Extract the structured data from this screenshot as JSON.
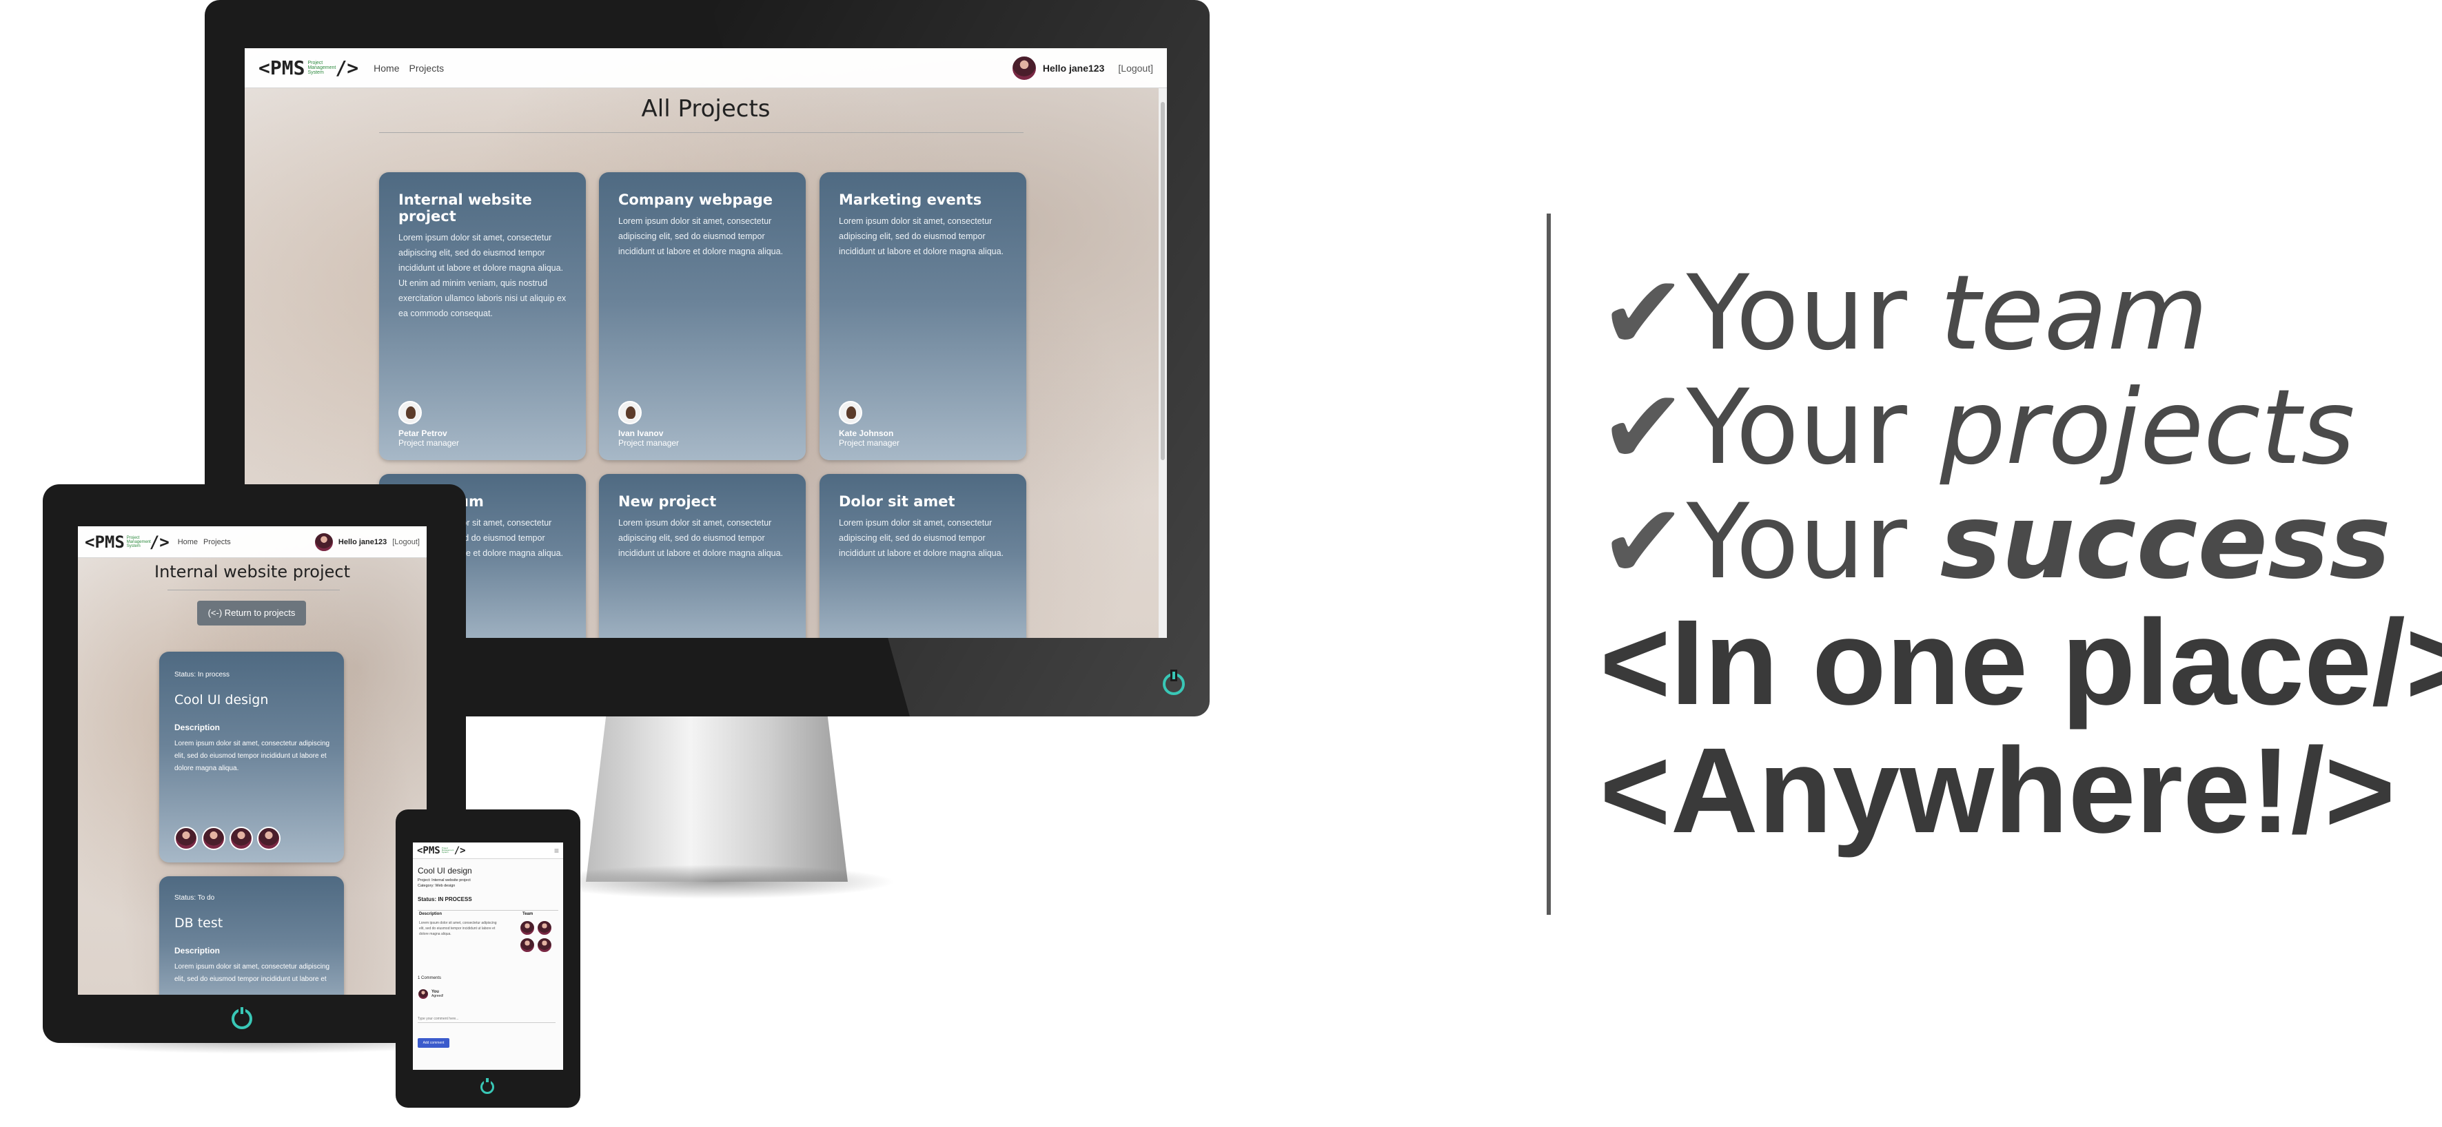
{
  "desktop": {
    "nav": {
      "logo_main": "<PMS",
      "logo_sub": "Project Management System",
      "logo_end": "/>",
      "home": "Home",
      "projects": "Projects",
      "user": "Hello jane123",
      "logout": "[Logout]"
    },
    "heading": "All Projects",
    "cards": [
      {
        "title": "Internal website project",
        "text": "Lorem ipsum dolor sit amet, consectetur adipiscing elit, sed do eiusmod tempor incididunt ut labore et dolore magna aliqua. Ut enim ad minim veniam, quis nostrud exercitation ullamco laboris nisi ut aliquip ex ea commodo consequat.",
        "manager": "Petar Petrov",
        "role": "Project manager"
      },
      {
        "title": "Company webpage",
        "text": "Lorem ipsum dolor sit amet, consectetur adipiscing elit, sed do eiusmod tempor incididunt ut labore et dolore magna aliqua.",
        "manager": "Ivan Ivanov",
        "role": "Project manager"
      },
      {
        "title": "Marketing events",
        "text": "Lorem ipsum dolor sit amet, consectetur adipiscing elit, sed do eiusmod tempor incididunt ut labore et dolore magna aliqua.",
        "manager": "Kate Johnson",
        "role": "Project manager"
      },
      {
        "title": "um",
        "text": "Lorem ipsum dolor sit amet, consectetur adipiscing elit, sed do eiusmod tempor incididunt ut labore et dolore magna aliqua."
      },
      {
        "title": "New project",
        "text": "Lorem ipsum dolor sit amet, consectetur adipiscing elit, sed do eiusmod tempor incididunt ut labore et dolore magna aliqua."
      },
      {
        "title": "Dolor sit amet",
        "text": "Lorem ipsum dolor sit amet, consectetur adipiscing elit, sed do eiusmod tempor incididunt ut labore et dolore magna aliqua."
      }
    ]
  },
  "tablet": {
    "nav": {
      "logo_main": "<PMS",
      "logo_sub": "Project Management System",
      "logo_end": "/>",
      "home": "Home",
      "projects": "Projects",
      "user": "Hello jane123",
      "logout": "[Logout]"
    },
    "heading": "Internal website project",
    "return_btn": "(<-) Return to projects",
    "tasks": [
      {
        "status": "Status: In process",
        "title": "Cool UI design",
        "desc_label": "Description",
        "desc": "Lorem ipsum dolor sit amet, consectetur adipiscing elit, sed do eiusmod tempor incididunt ut labore et dolore magna aliqua."
      },
      {
        "status": "Status: To do",
        "title": "DB test",
        "desc_label": "Description",
        "desc": "Lorem ipsum dolor sit amet, consectetur adipiscing elit, sed do eiusmod tempor incididunt ut labore et"
      }
    ]
  },
  "phone": {
    "nav": {
      "logo_main": "<PMS",
      "logo_sub": "Project Management System",
      "logo_end": "/>",
      "menu": "≡"
    },
    "title": "Cool UI design",
    "project_line": "Project: Internal website project",
    "category_line": "Category: Web design",
    "status": "Status: IN PROCESS",
    "col_desc": "Description",
    "col_team": "Team",
    "desc": "Lorem ipsum dolor sit amet, consectetur adipiscing elit, sed do eiusmod tempor incididunt ut labore et dolore magna aliqua.",
    "comments_label": "1 Comments",
    "comment_user": "You",
    "comment_text": "Agreed!",
    "comment_placeholder": "Type your comment here...",
    "comment_btn": "Add comment"
  },
  "slogan": {
    "check": "✔",
    "line1_a": "Your ",
    "line1_b": "team",
    "line2_a": "Your ",
    "line2_b": "projects",
    "line3_a": "Your ",
    "line3_b": "success",
    "line4": "<In one place/>",
    "line5": "<Anywhere!/>"
  },
  "colors": {
    "card": "#56708a",
    "power": "#39c7b6",
    "slogan": "#4a4a4a",
    "logo_sub": "#2e8b3f"
  }
}
